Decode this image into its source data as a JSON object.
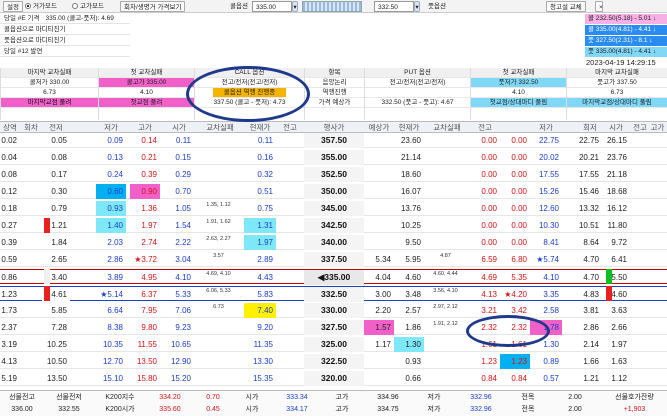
{
  "toolbar": {
    "settings": "설정",
    "radio_price": "거가모드",
    "radio_fix": "고가모드",
    "view_tabs": "회차/생명거 가격보기",
    "product_label": "콜옵션",
    "call_value": "335.00",
    "futures_value": "332.50",
    "put_label": "풋옵션",
    "order_btn": "청고설 교체"
  },
  "left_panel": {
    "rows": [
      "당일 #E 기격",
      "콜옵션으로 마디티진기",
      "풋옵션으로 마디티진기",
      "당일 #12 발연"
    ],
    "row0_value": "335.00 (콜고-풋저): 4.69"
  },
  "right_stack": [
    "콜 232.50(5.18) - 5.01 ↓",
    "콜 335.00(4.81) - 4.41 ↓",
    "풋 327.50(2.31) - 8.1 ↓",
    "풋 335.00(4.81) - 4.41 ↓"
  ],
  "datetime": "2023-04-19 14:29:15",
  "headers": {
    "c1": {
      "title": "마지막 교차실패",
      "l1": "콜저가 330.00",
      "l2": "6.73",
      "l3": "마지막교점 풀려"
    },
    "c2": {
      "title": "첫 교차실패",
      "l1": "콜고가 335.00",
      "l2": "4.10",
      "l3": "첫교점 풀려"
    },
    "c3": {
      "title": "CALL 옵션",
      "l1": "전고/전저(전고/전저)",
      "l2": "콜옵션 역행 진행중",
      "l3": "337.50 (콜고 - 풋저): 4.73"
    },
    "c4": {
      "title": "항목",
      "l1": "음양논리",
      "l2": "역행진행",
      "l3": "가격 예상가"
    },
    "c5": {
      "title": "PUT 옵션",
      "l1": "전고/전저(전고/전저)",
      "l2": "",
      "l3": "332.50 (풋고 - 풋고): 4.67"
    },
    "c6": {
      "title": "첫 교차실패",
      "l1": "풋저가 332.50",
      "l2": "4.10",
      "l3": "첫교점/상대마디 풀림"
    },
    "c7": {
      "title": "마지막 교차실패",
      "l1": "풋고가 337.50",
      "l2": "6.73",
      "l3": "마지막교점/상대마디 풀림"
    }
  },
  "columns": [
    "상역",
    "회차",
    "전저",
    "저가",
    "고가",
    "시가",
    "교차실패",
    "현재가",
    "전고",
    "행사가",
    "예상가",
    "현재가",
    "교차실패",
    "전고",
    "저가",
    "회저",
    "시가",
    "전고",
    "고가"
  ],
  "rows": [
    {
      "a": "0.02",
      "b": "",
      "c": "0.05",
      "d": "0.09",
      "e": "0.14",
      "f": "0.11",
      "g": "",
      "h": "0.11",
      "strike": "357.50",
      "i": "",
      "j": "23.60",
      "k": "",
      "l": "0.00",
      "m": "0.00",
      "n": "22.75",
      "o": "22.75",
      "p": "26.15"
    },
    {
      "a": "0.04",
      "b": "",
      "c": "0.08",
      "d": "0.13",
      "e": "0.21",
      "f": "0.15",
      "g": "",
      "h": "0.16",
      "strike": "355.00",
      "i": "",
      "j": "21.14",
      "k": "",
      "l": "0.00",
      "m": "0.00",
      "n": "20.02",
      "o": "20.21",
      "p": "23.76"
    },
    {
      "a": "0.08",
      "b": "",
      "c": "0.17",
      "d": "0.24",
      "e": "0.39",
      "f": "0.29",
      "g": "",
      "h": "0.32",
      "strike": "352.50",
      "i": "",
      "j": "18.60",
      "k": "",
      "l": "0.00",
      "m": "0.00",
      "n": "17.55",
      "o": "17.55",
      "p": "21.18"
    },
    {
      "a": "0.12",
      "b": "",
      "c": "0.30",
      "d": "0.60",
      "e": "0.90",
      "f": "0.70",
      "g": "",
      "h": "0.51",
      "strike": "350.00",
      "i": "",
      "j": "16.07",
      "k": "",
      "l": "0.00",
      "m": "0.00",
      "n": "15.26",
      "o": "15.46",
      "p": "18.68"
    },
    {
      "a": "0.18",
      "b": "",
      "c": "0.79",
      "d": "0.93",
      "e": "1.36",
      "f": "1.05",
      "g": "1.35, 1.12",
      "h": "0.75",
      "strike": "345.00",
      "i": "",
      "j": "13.76",
      "k": "",
      "l": "0.00",
      "m": "0.00",
      "n": "12.60",
      "o": "13.32",
      "p": "16.12"
    },
    {
      "a": "0.27",
      "b": "",
      "c": "1.21",
      "d": "1.40",
      "e": "1.97",
      "f": "1.54",
      "g": "1.91, 1.62",
      "h": "1.31",
      "strike": "342.50",
      "i": "",
      "j": "10.25",
      "k": "",
      "l": "0.00",
      "m": "0.00",
      "n": "10.30",
      "o": "10.51",
      "p": "11.80"
    },
    {
      "a": "0.39",
      "b": "",
      "c": "1.84",
      "d": "2.03",
      "e": "2.74",
      "f": "2.22",
      "g": "2.63, 2.27",
      "h": "1.97",
      "strike": "340.00",
      "i": "",
      "j": "9.50",
      "k": "",
      "l": "0.00",
      "m": "0.00",
      "n": "8.41",
      "o": "8.64",
      "p": "9.72"
    },
    {
      "a": "0.59",
      "b": "",
      "c": "2.65",
      "d": "2.86",
      "e": "★3.72",
      "f": "3.04",
      "g": "3.57",
      "h": "2.89",
      "strike": "337.50",
      "i": "5.34",
      "j": "5.95",
      "k": "4.87",
      "l": "6.59",
      "m": "6.80",
      "n": "★5.74",
      "o": "4.70",
      "p": "6.41"
    },
    {
      "a": "0.86",
      "b": "",
      "c": "3.40",
      "d": "3.89",
      "e": "4.95",
      "f": "4.10",
      "g": "4.69, 4.10",
      "h": "4.43",
      "strike": "◀335.00",
      "i": "4.04",
      "j": "4.60",
      "k": "4.60, 4.44",
      "l": "4.69",
      "m": "5.35",
      "n": "4.10",
      "o": "4.70",
      "p": "5.50"
    },
    {
      "a": "1.23",
      "b": "",
      "c": "4.61",
      "d": "★5.14",
      "e": "6.37",
      "f": "5.33",
      "g": "6.06, 5.33",
      "h": "5.83",
      "strike": "332.50",
      "i": "3.00",
      "j": "3.48",
      "k": "3.56, 4.10",
      "l": "4.13",
      "m": "★4.20",
      "n": "3.35",
      "o": "4.83",
      "p": "4.60"
    },
    {
      "a": "1.73",
      "b": "",
      "c": "5.85",
      "d": "6.64",
      "e": "7.95",
      "f": "7.06",
      "g": "6.73",
      "h": "7.40",
      "strike": "330.00",
      "i": "2.20",
      "j": "2.57",
      "k": "2.97, 2.12",
      "l": "3.21",
      "m": "3.42",
      "n": "2.58",
      "o": "3.81",
      "p": "3.63"
    },
    {
      "a": "2.37",
      "b": "",
      "c": "7.28",
      "d": "8.38",
      "e": "9.80",
      "f": "9.23",
      "g": "",
      "h": "9.20",
      "strike": "327.50",
      "i": "1.57",
      "j": "1.86",
      "k": "1.91, 2.12",
      "l": "2.32",
      "m": "2.32",
      "n": "1.78",
      "o": "2.86",
      "p": "2.66"
    },
    {
      "a": "3.19",
      "b": "",
      "c": "10.25",
      "d": "10.35",
      "e": "11.55",
      "f": "10.65",
      "g": "",
      "h": "11.35",
      "strike": "325.00",
      "i": "1.17",
      "j": "1.30",
      "k": "",
      "l": "1.61",
      "m": "1.61",
      "n": "1.30",
      "o": "2.14",
      "p": "1.97"
    },
    {
      "a": "4.13",
      "b": "",
      "c": "10.50",
      "d": "12.70",
      "e": "13.50",
      "f": "12.90",
      "g": "",
      "h": "13.30",
      "strike": "322.50",
      "i": "",
      "j": "0.93",
      "k": "",
      "l": "1.23",
      "m": "1.23",
      "n": "0.89",
      "o": "1.66",
      "p": "1.63"
    },
    {
      "a": "5.19",
      "b": "",
      "c": "13.50",
      "d": "15.10",
      "e": "15.80",
      "f": "15.20",
      "g": "",
      "h": "15.35",
      "strike": "320.00",
      "i": "",
      "j": "0.66",
      "k": "",
      "l": "0.84",
      "m": "0.84",
      "n": "0.57",
      "o": "1.21",
      "p": "1.12"
    }
  ],
  "bottom": {
    "r1": [
      "선물전고",
      "선물전저",
      "K200지수",
      "334.20",
      "0.70",
      "시가",
      "333.34",
      "고가",
      "334.96",
      "저가",
      "332.96",
      "전목",
      "2.00",
      "선물호가잔량"
    ],
    "r2": [
      "336.00",
      "332.55",
      "K200시가",
      "335.60",
      "0.45",
      "시가",
      "334.17",
      "고가",
      "334.75",
      "저가",
      "332.96",
      "전목",
      "2.00",
      "+1,903"
    ]
  }
}
